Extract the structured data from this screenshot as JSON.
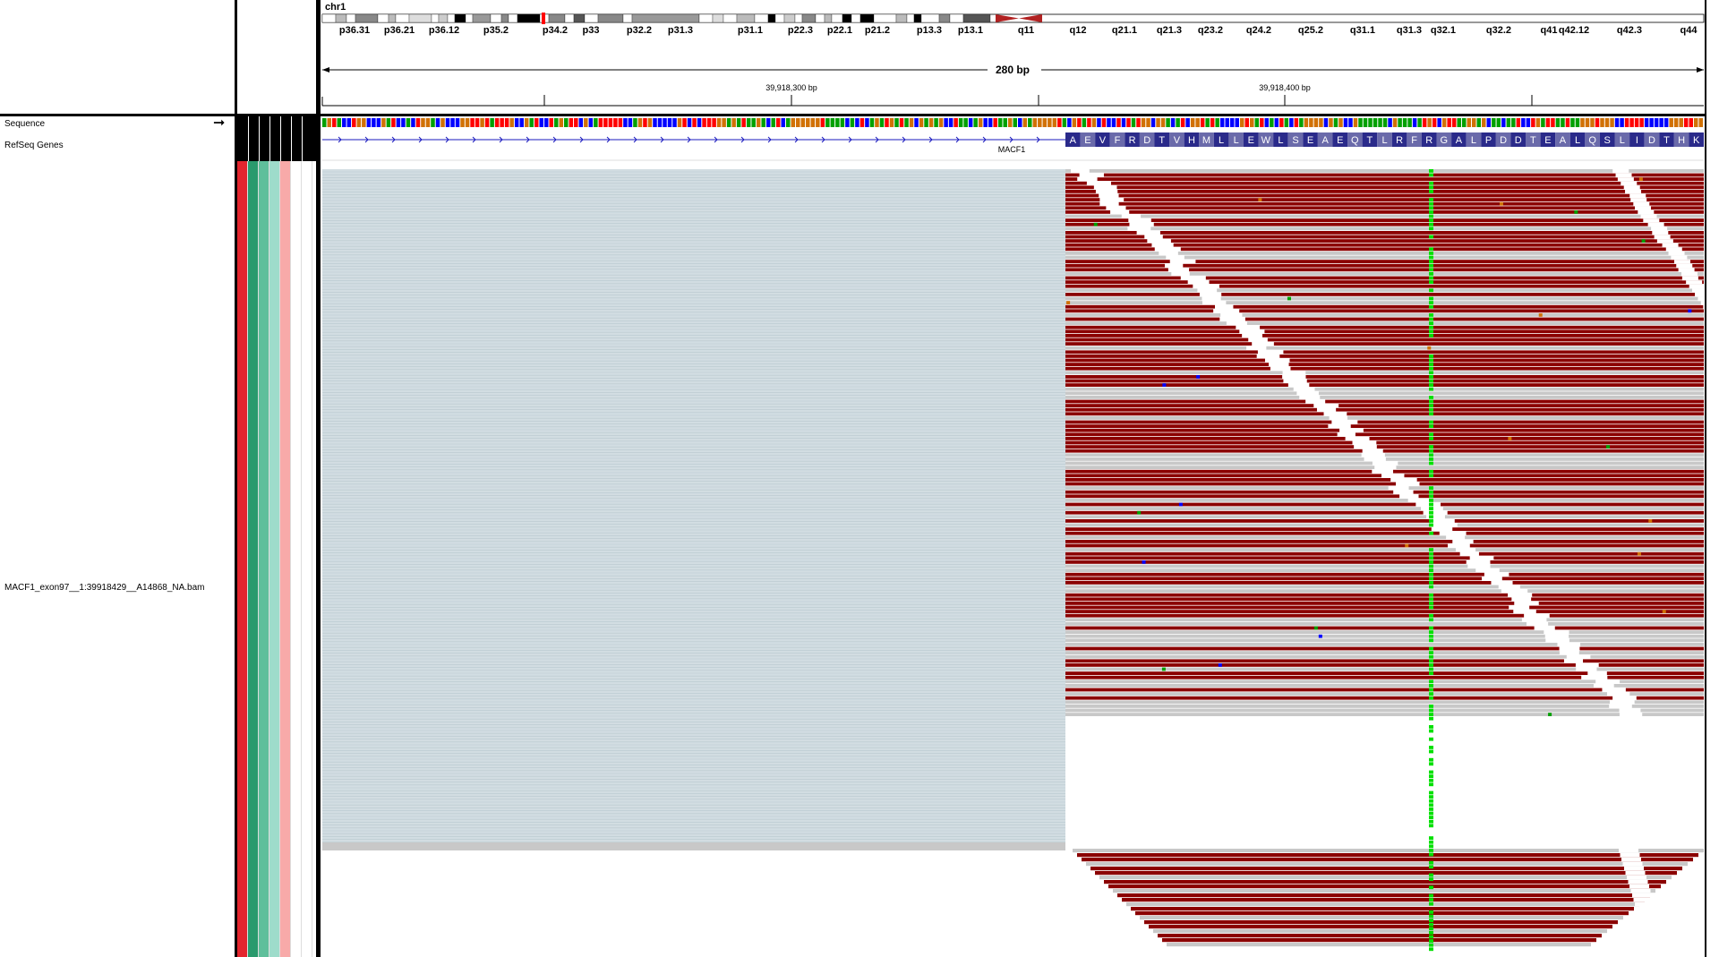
{
  "locus": {
    "chromosome": "chr1",
    "span": "280 bp",
    "ticks": [
      "39,918,300 bp",
      "39,918,400 bp"
    ]
  },
  "ideogram": {
    "bands": [
      "p36.31",
      "p36.21",
      "p36.12",
      "p35.2",
      "p34.2",
      "p33",
      "p32.2",
      "p31.3",
      "p31.1",
      "p22.3",
      "p22.1",
      "p21.2",
      "p13.3",
      "p13.1",
      "q11",
      "q12",
      "q21.1",
      "q21.3",
      "q23.2",
      "q24.2",
      "q25.2",
      "q31.1",
      "q31.3",
      "q32.1",
      "q32.2",
      "q41",
      "q42.12",
      "q42.3",
      "q44"
    ]
  },
  "tracks": {
    "sequence": "Sequence",
    "refseq": "RefSeq Genes",
    "bam": "MACF1_exon97__1:39918429__A14868_NA.bam"
  },
  "gene": {
    "name": "MACF1",
    "amino_acids": [
      "A",
      "E",
      "V",
      "F",
      "R",
      "D",
      "T",
      "V",
      "H",
      "M",
      "L",
      "L",
      "E",
      "W",
      "L",
      "S",
      "E",
      "A",
      "E",
      "Q",
      "T",
      "L",
      "R",
      "F",
      "R",
      "G",
      "A",
      "L",
      "P",
      "D",
      "D",
      "T",
      "E",
      "A",
      "L",
      "Q",
      "S",
      "L",
      "I",
      "D",
      "T",
      "H",
      "K"
    ]
  },
  "colors": {
    "read_red": "#8b0000",
    "read_grey": "#c8c8c8",
    "soft_clip": "#d2dde2",
    "snp_green": "#00e000",
    "gene_blue": "#1b1bbf",
    "aa_dark": "#2a2a8a",
    "aa_light": "#6a6aaa",
    "attr_colors": [
      "#e3262e",
      "#2a9a6d",
      "#5fbf9b",
      "#9edccb",
      "#f8aaa9",
      "#ffffff",
      "#ffffff"
    ]
  },
  "icons": {
    "strand_arrow": "right-arrow-icon"
  }
}
